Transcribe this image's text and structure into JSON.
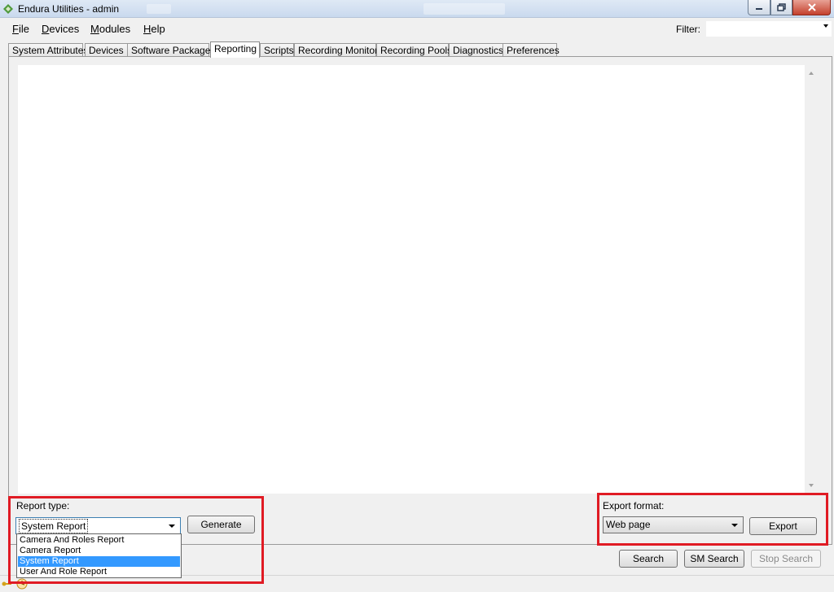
{
  "window": {
    "title": "Endura Utilities - admin",
    "icons": {
      "app": "endura-logo-icon",
      "minimize": "minimize-icon",
      "maximize": "restore-icon",
      "close": "close-icon"
    }
  },
  "menu": {
    "items": [
      {
        "label": "File",
        "mnemonic": "F"
      },
      {
        "label": "Devices",
        "mnemonic": "D"
      },
      {
        "label": "Modules",
        "mnemonic": "M"
      },
      {
        "label": "Help",
        "mnemonic": "H"
      }
    ],
    "filter_label": "Filter:",
    "filter_value": ""
  },
  "tabs": [
    {
      "label": "System Attributes",
      "active": false
    },
    {
      "label": "Devices",
      "active": false
    },
    {
      "label": "Software Packages",
      "active": false
    },
    {
      "label": "Reporting",
      "active": true
    },
    {
      "label": "Scripts",
      "active": false
    },
    {
      "label": "Recording Monitor",
      "active": false
    },
    {
      "label": "Recording Pools",
      "active": false
    },
    {
      "label": "Diagnostics",
      "active": false
    },
    {
      "label": "Preferences",
      "active": false
    }
  ],
  "report": {
    "type_label": "Report type:",
    "selected": "System Report",
    "options": [
      "Camera And Roles Report",
      "Camera Report",
      "System Report",
      "User And Role Report"
    ],
    "generate_label": "Generate"
  },
  "export": {
    "format_label": "Export format:",
    "selected": "Web page",
    "export_label": "Export"
  },
  "search": {
    "search_label": "Search",
    "sm_search_label": "SM Search",
    "stop_search_label": "Stop Search"
  },
  "colors": {
    "highlight": "#e01b24",
    "selection": "#3399ff",
    "window_bg": "#f0f0f0"
  }
}
